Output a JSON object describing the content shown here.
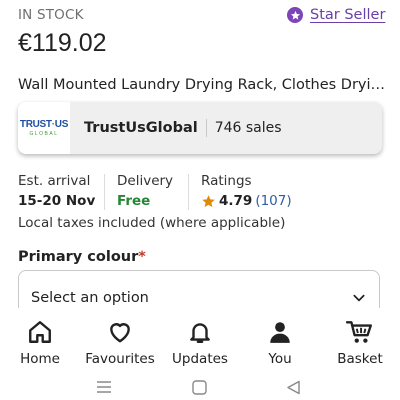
{
  "availability": "IN STOCK",
  "star_seller": {
    "label": "Star Seller",
    "icon": "star-seller-badge-icon",
    "color": "#7c45b8"
  },
  "price": "€119.02",
  "product_title": "Wall Mounted Laundry Drying Rack, Clothes Drying...",
  "shop": {
    "logo_line1_a": "TRUST",
    "logo_line1_b": "US",
    "logo_line2": "GLOBAL",
    "name": "TrustUsGlobal",
    "sales": "746 sales"
  },
  "delivery_info": {
    "arrival_label": "Est. arrival",
    "arrival_value": "15-20 Nov",
    "delivery_label": "Delivery",
    "delivery_value": "Free",
    "ratings_label": "Ratings",
    "rating_value": "4.79",
    "rating_count": "(107)"
  },
  "taxes_note": "Local taxes included (where applicable)",
  "variation": {
    "label": "Primary colour",
    "required_mark": "*",
    "placeholder": "Select an option"
  },
  "bottom_nav": [
    {
      "label": "Home",
      "icon": "home-icon"
    },
    {
      "label": "Favourites",
      "icon": "heart-icon"
    },
    {
      "label": "Updates",
      "icon": "bell-icon"
    },
    {
      "label": "You",
      "icon": "person-icon"
    },
    {
      "label": "Basket",
      "icon": "basket-icon"
    }
  ],
  "system_nav": [
    "recents-icon",
    "home-icon",
    "back-icon"
  ],
  "colors": {
    "accent": "#7c45b8",
    "free": "#258635",
    "link": "#2f5ea8",
    "star": "#e08a00"
  }
}
